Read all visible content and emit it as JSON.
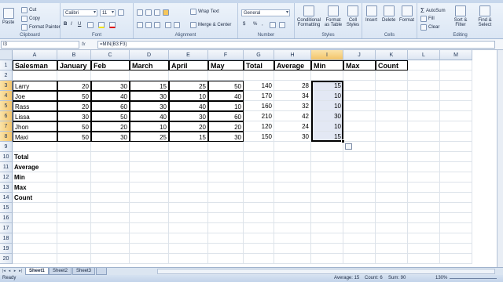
{
  "ribbon": {
    "clipboard": {
      "label": "Clipboard",
      "paste": "Paste",
      "cut": "Cut",
      "copy": "Copy",
      "format_painter": "Format Painter"
    },
    "font": {
      "label": "Font",
      "family": "Calibri",
      "size": "11",
      "bold": "B",
      "italic": "I",
      "underline": "U"
    },
    "alignment": {
      "label": "Alignment",
      "wrap_text": "Wrap Text",
      "merge_center": "Merge & Center"
    },
    "number": {
      "label": "Number",
      "format": "General",
      "currency": "$",
      "percent": "%",
      "comma": ","
    },
    "styles": {
      "label": "Styles",
      "conditional": "Conditional Formatting",
      "format_table": "Format as Table",
      "cell_styles": "Cell Styles"
    },
    "cells": {
      "label": "Cells",
      "insert": "Insert",
      "delete": "Delete",
      "format": "Format"
    },
    "editing": {
      "label": "Editing",
      "autosum": "AutoSum",
      "fill": "Fill",
      "clear": "Clear",
      "sort_filter": "Sort & Filter",
      "find_select": "Find & Select"
    }
  },
  "formula_bar": {
    "name_box": "I3",
    "fx": "fx",
    "formula": "=MIN(B3:F3)"
  },
  "columns": [
    "A",
    "B",
    "C",
    "D",
    "E",
    "F",
    "G",
    "H",
    "I",
    "J",
    "K",
    "L",
    "M"
  ],
  "rows": [
    "1",
    "2",
    "3",
    "4",
    "5",
    "6",
    "7",
    "8",
    "9",
    "10",
    "11",
    "12",
    "13",
    "14",
    "15",
    "16",
    "17",
    "18",
    "19",
    "20"
  ],
  "headers": [
    "Salesman",
    "January",
    "Feb",
    "March",
    "April",
    "May",
    "Total",
    "Average",
    "Min",
    "Max",
    "Count"
  ],
  "data": [
    {
      "name": "Larry",
      "jan": "20",
      "feb": "30",
      "mar": "15",
      "apr": "25",
      "may": "50",
      "total": "140",
      "avg": "28",
      "min": "15"
    },
    {
      "name": "Joe",
      "jan": "50",
      "feb": "40",
      "mar": "30",
      "apr": "10",
      "may": "40",
      "total": "170",
      "avg": "34",
      "min": "10"
    },
    {
      "name": "Rass",
      "jan": "20",
      "feb": "60",
      "mar": "30",
      "apr": "40",
      "may": "10",
      "total": "160",
      "avg": "32",
      "min": "10"
    },
    {
      "name": "Lissa",
      "jan": "30",
      "feb": "50",
      "mar": "40",
      "apr": "30",
      "may": "60",
      "total": "210",
      "avg": "42",
      "min": "30"
    },
    {
      "name": "Jhon",
      "jan": "50",
      "feb": "20",
      "mar": "10",
      "apr": "20",
      "may": "20",
      "total": "120",
      "avg": "24",
      "min": "10"
    },
    {
      "name": "Maxi",
      "jan": "50",
      "feb": "30",
      "mar": "25",
      "apr": "15",
      "may": "30",
      "total": "150",
      "avg": "30",
      "min": "15"
    }
  ],
  "summary_labels": [
    "Total",
    "Average",
    "Min",
    "Max",
    "Count"
  ],
  "sheets": [
    "Sheet1",
    "Sheet2",
    "Sheet3"
  ],
  "status": {
    "ready": "Ready",
    "average": "Average: 15",
    "count": "Count: 6",
    "sum": "Sum: 90",
    "zoom": "130%"
  }
}
